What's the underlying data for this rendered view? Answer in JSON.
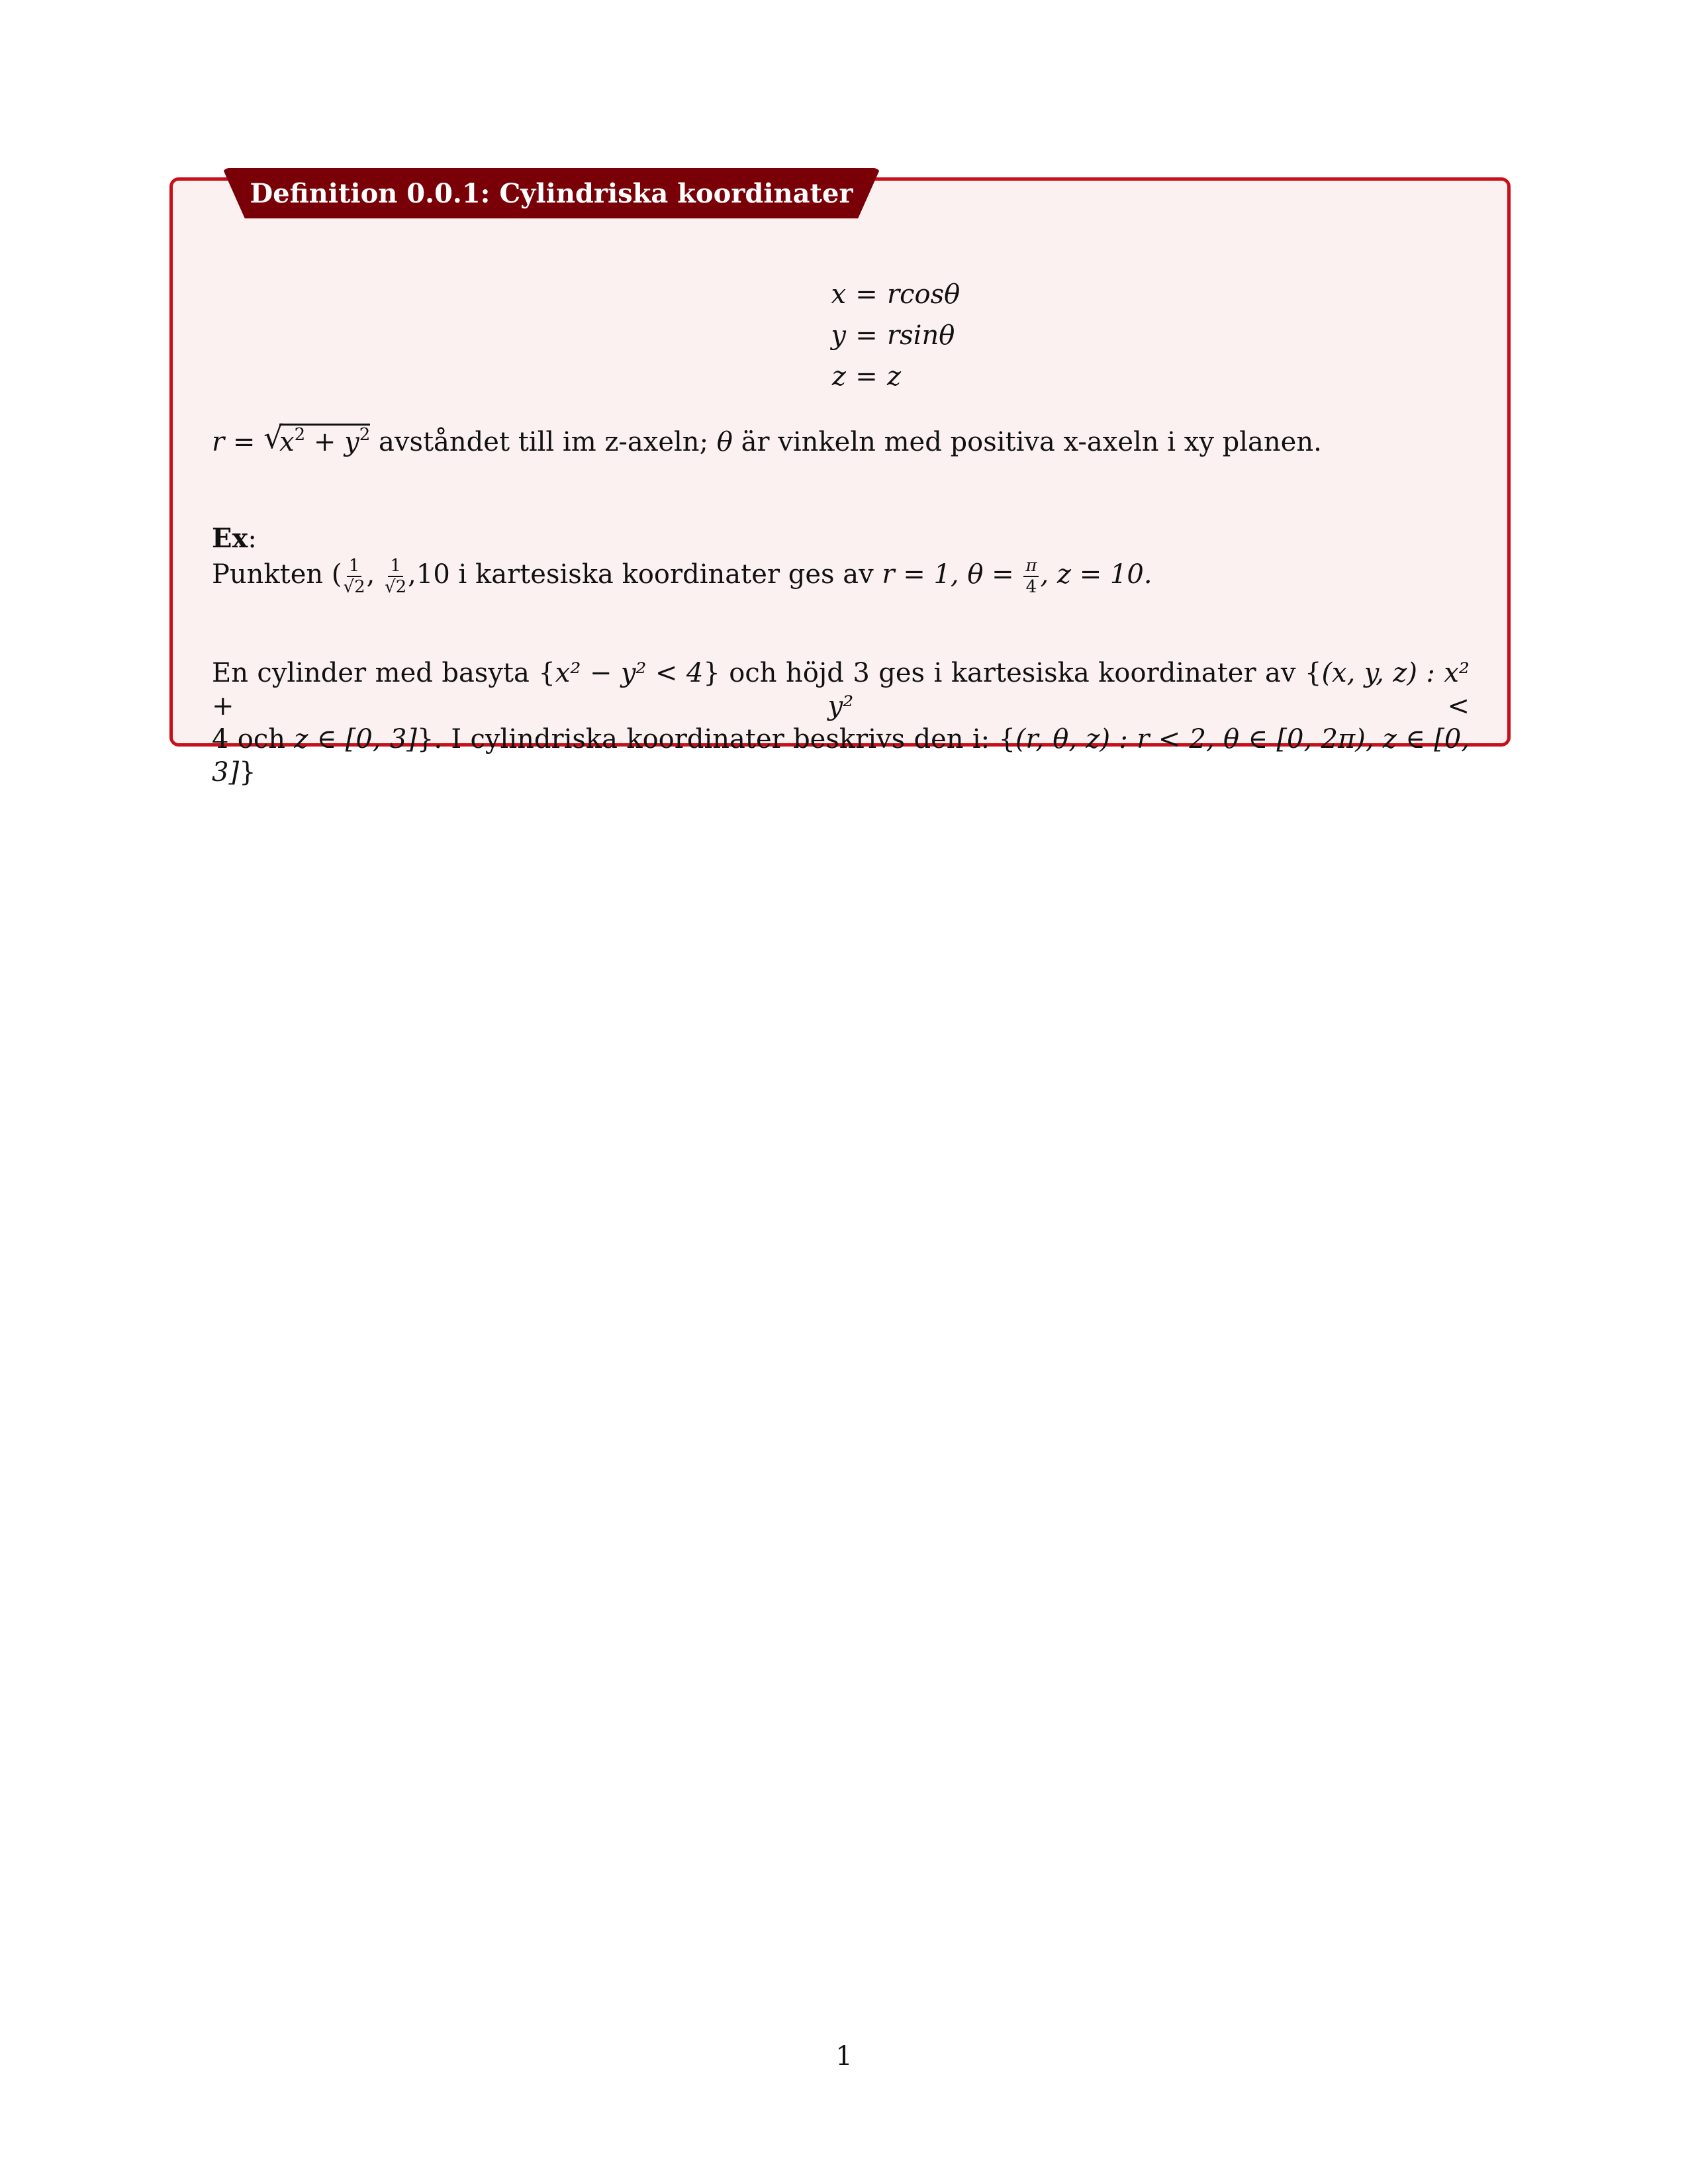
{
  "definition": {
    "title": "Definition 0.0.1: Cylindriska koordinater",
    "equations": [
      {
        "lhs": "x",
        "op": "=",
        "rhs": "rcosθ"
      },
      {
        "lhs": "y",
        "op": "=",
        "rhs": "rsinθ"
      },
      {
        "lhs": "z",
        "op": "=",
        "rhs": "z"
      }
    ],
    "r_line": {
      "r": "r",
      "eq": "=",
      "radicand_a": "x",
      "exp_a": "2",
      "plus": "+",
      "radicand_b": "y",
      "exp_b": "2",
      "text_1": " avståndet till im z-axeln; ",
      "theta": "θ",
      "text_2": " är vinkeln med positiva x-axeln i xy planen."
    },
    "example_label": "Ex",
    "example_colon": ":",
    "example_line": {
      "prefix": "Punkten (",
      "frac_num": "1",
      "frac_den": "√2",
      "comma": ",",
      "after": "10 i kartesiska koordinater ges av ",
      "r_expr": "r = 1, θ = ",
      "pi_num": "π",
      "pi_den": "4",
      "tail": ", z = 10."
    },
    "cylinder_line_1_a": "En cylinder med basyta {",
    "cylinder_line_1_b": "x² − y² < 4",
    "cylinder_line_1_c": "} och höjd 3 ges i kartesiska koordinater av {",
    "cylinder_line_1_d": "(x, y, z) : x² + y² <",
    "cylinder_line_2_a": "4 och ",
    "cylinder_line_2_b": "z ∈ [0, 3]",
    "cylinder_line_2_c": "}. I cylindriska koordinater beskrivs den i: {",
    "cylinder_line_2_d": "(r, θ, z) : r < 2, θ ∈ [0, 2π), z ∈ [0, 3]",
    "cylinder_line_2_e": "}"
  },
  "page_number": "1",
  "colors": {
    "frame": "#c7101c",
    "tab": "#7a0008",
    "box_bg": "#fcf1f1"
  }
}
